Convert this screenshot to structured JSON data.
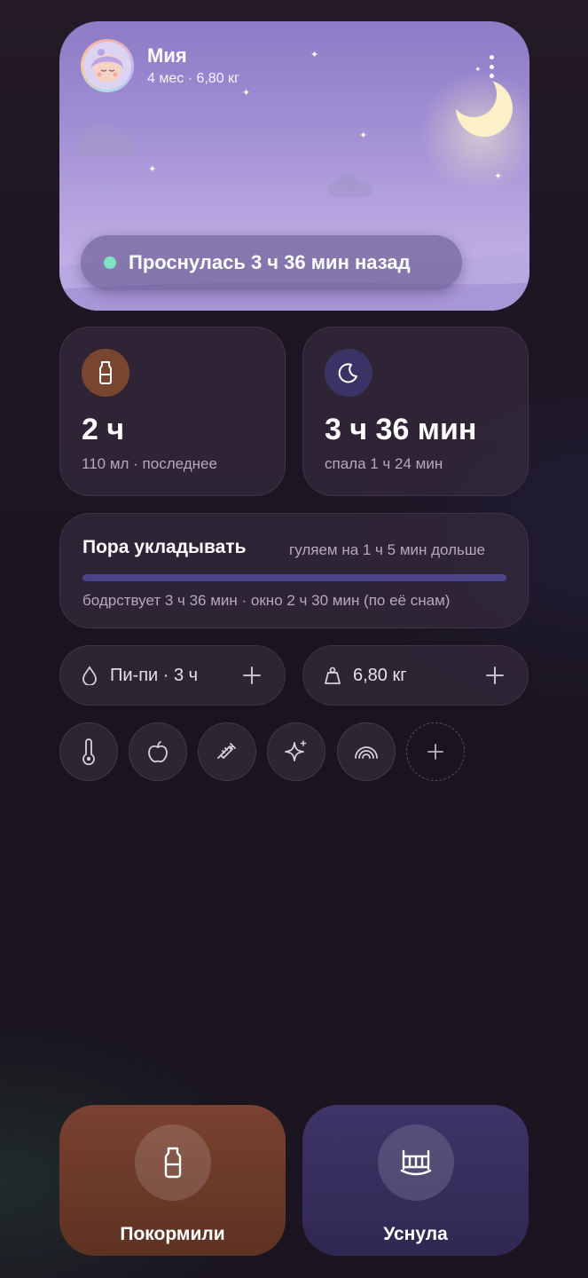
{
  "hero": {
    "name": "Мия",
    "meta": "4 мес · 6,80 кг",
    "status": "Проснулась 3 ч 36 мин назад"
  },
  "feed_card": {
    "value": "2 ч",
    "subtitle": "110 мл · последнее",
    "icon": "bottle-icon",
    "accent": "#7a4630"
  },
  "sleep_card": {
    "value": "3 ч 36 мин",
    "subtitle": "спала 1 ч 24 мин",
    "icon": "moon-icon",
    "accent": "#3a3466"
  },
  "wake_window": {
    "title": "Пора укладывать",
    "note": "гуляем на 1 ч 5 мин дольше",
    "detail": "бодрствует 3 ч 36 мин · окно 2 ч 30 мин (по её снам)",
    "progress": 1.0
  },
  "quick_pills": [
    {
      "label": "Пи-пи · 3 ч",
      "icon": "drop-icon"
    },
    {
      "label": "6,80 кг",
      "icon": "weight-icon"
    }
  ],
  "quick_icons": [
    "thermometer-icon",
    "apple-icon",
    "syringe-icon",
    "sparkle-icon",
    "rainbow-icon",
    "plus-icon"
  ],
  "actions": {
    "feed_label": "Покормили",
    "sleep_label": "Уснула",
    "feed_color": "#6e3a28",
    "sleep_color": "#3a3060"
  }
}
